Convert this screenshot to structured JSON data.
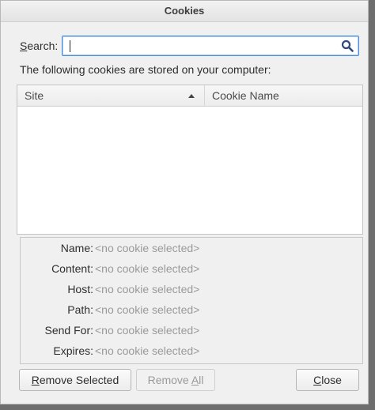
{
  "window": {
    "title": "Cookies"
  },
  "search": {
    "label_prefix": "",
    "label_accel": "S",
    "label_rest": "earch:",
    "value": "",
    "placeholder": ""
  },
  "info_text": "The following cookies are stored on your computer:",
  "tree": {
    "columns": [
      {
        "label": "Site",
        "sorted": "ascending"
      },
      {
        "label": "Cookie Name"
      }
    ],
    "rows": []
  },
  "details": [
    {
      "label": "Name:",
      "value": "<no cookie selected>"
    },
    {
      "label": "Content:",
      "value": "<no cookie selected>"
    },
    {
      "label": "Host:",
      "value": "<no cookie selected>"
    },
    {
      "label": "Path:",
      "value": "<no cookie selected>"
    },
    {
      "label": "Send For:",
      "value": "<no cookie selected>"
    },
    {
      "label": "Expires:",
      "value": "<no cookie selected>"
    }
  ],
  "buttons": {
    "remove_selected": {
      "accel": "R",
      "rest": "emove Selected",
      "enabled": true
    },
    "remove_all": {
      "pre": "Remove ",
      "accel": "A",
      "rest": "ll",
      "enabled": false
    },
    "close": {
      "accel": "C",
      "rest": "lose",
      "enabled": true
    }
  },
  "colors": {
    "focus_border": "#4a90d9",
    "disabled_text": "#9a9a9a",
    "search_icon": "#2f4a7a"
  }
}
